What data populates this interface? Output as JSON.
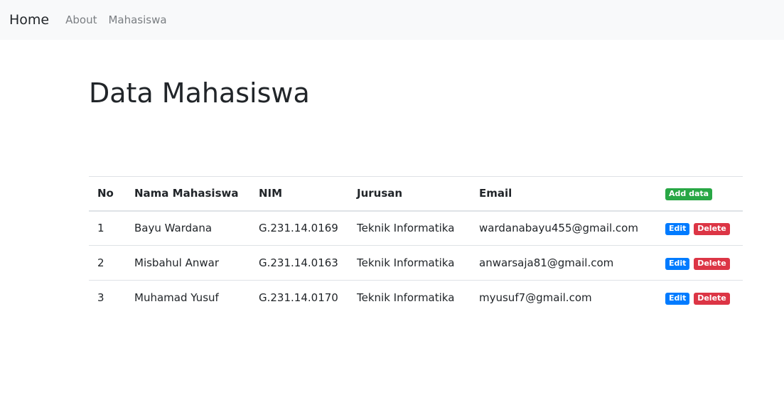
{
  "navbar": {
    "brand": "Home",
    "links": [
      "About",
      "Mahasiswa"
    ]
  },
  "page": {
    "title": "Data Mahasiswa"
  },
  "table": {
    "headers": [
      "No",
      "Nama Mahasiswa",
      "NIM",
      "Jurusan",
      "Email"
    ],
    "add_label": "Add data",
    "edit_label": "Edit",
    "delete_label": "Delete",
    "rows": [
      {
        "no": "1",
        "nama": "Bayu Wardana",
        "nim": "G.231.14.0169",
        "jurusan": "Teknik Informatika",
        "email": "wardanabayu455@gmail.com"
      },
      {
        "no": "2",
        "nama": "Misbahul Anwar",
        "nim": "G.231.14.0163",
        "jurusan": "Teknik Informatika",
        "email": "anwarsaja81@gmail.com"
      },
      {
        "no": "3",
        "nama": "Muhamad Yusuf",
        "nim": "G.231.14.0170",
        "jurusan": "Teknik Informatika",
        "email": "myusuf7@gmail.com"
      }
    ]
  },
  "colors": {
    "navbar_bg": "#f8f9fa",
    "success": "#28a745",
    "primary": "#007bff",
    "danger": "#dc3545"
  }
}
